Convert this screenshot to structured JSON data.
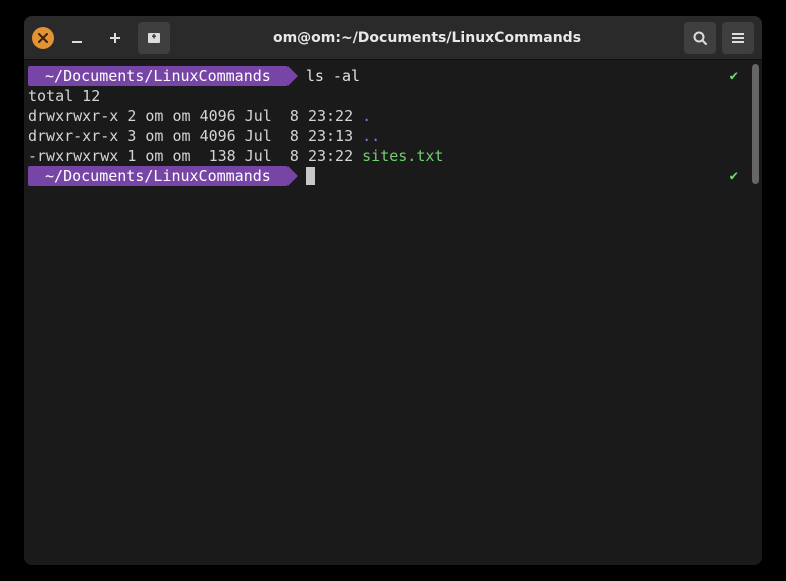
{
  "titlebar": {
    "title": "om@om:~/Documents/LinuxCommands"
  },
  "prompt": {
    "path": "~/Documents/LinuxCommands"
  },
  "session": {
    "command1": "ls -al",
    "total_line": "total 12",
    "rows": [
      {
        "perm": "drwxrwxr-x 2 om om 4096 Jul  8 23:22 ",
        "name": ".",
        "cls": "dir"
      },
      {
        "perm": "drwxr-xr-x 3 om om 4096 Jul  8 23:13 ",
        "name": "..",
        "cls": "dir"
      },
      {
        "perm": "-rwxrwxrwx 1 om om  138 Jul  8 23:22 ",
        "name": "sites.txt",
        "cls": "file"
      }
    ]
  }
}
